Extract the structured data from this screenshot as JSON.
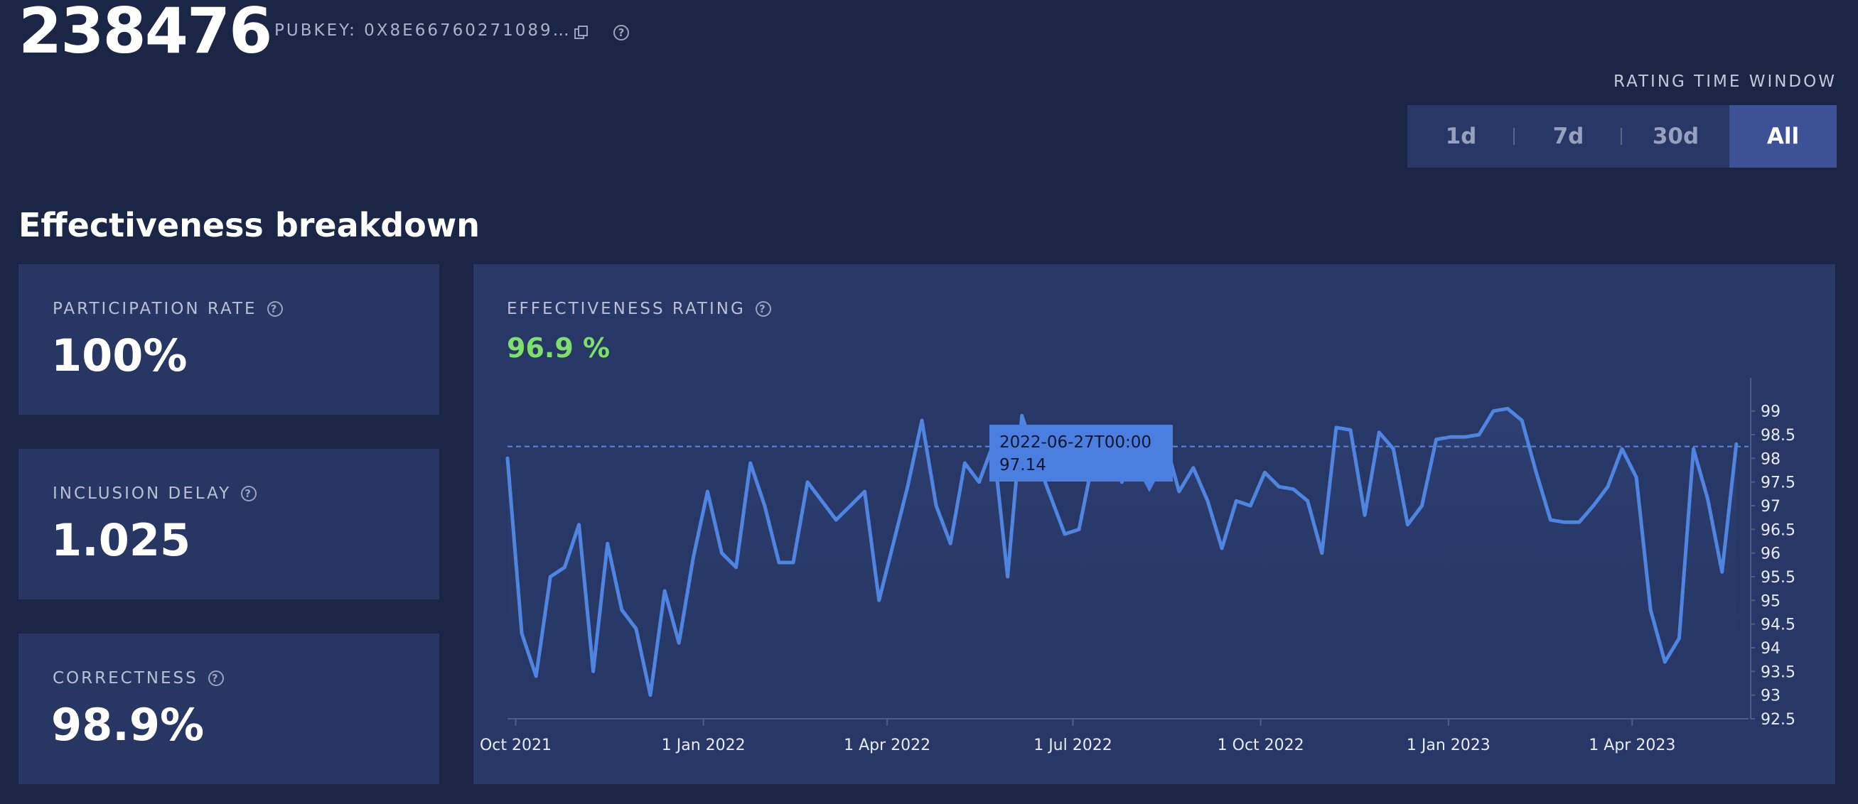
{
  "header": {
    "validator_index": "238476",
    "pubkey": "PUBKEY: 0X8E66760271089…",
    "copy_icon": "copy-icon",
    "help_icon": "help-circle-icon"
  },
  "time_window": {
    "label": "RATING TIME WINDOW",
    "options": [
      "1d",
      "7d",
      "30d",
      "All"
    ],
    "selected": "All"
  },
  "section_title": "Effectiveness breakdown",
  "metrics": [
    {
      "label": "PARTICIPATION RATE",
      "value": "100%"
    },
    {
      "label": "INCLUSION DELAY",
      "value": "1.025"
    },
    {
      "label": "CORRECTNESS",
      "value": "98.9%"
    }
  ],
  "rating": {
    "label": "EFFECTIVENESS RATING",
    "value": "96.9 %"
  },
  "colors": {
    "background": "#1b2647",
    "panel": "#283866",
    "line": "#4f85e0",
    "rating_value": "#7ee06a",
    "tooltip": "#4a7fe0"
  },
  "chart_data": {
    "type": "line",
    "title": "",
    "xlabel": "",
    "ylabel": "",
    "ylim": [
      92.5,
      99.4
    ],
    "xlim": [
      "2021-09-27",
      "2023-05-28"
    ],
    "x_ticks": [
      "Oct 2021",
      "1 Jan 2022",
      "1 Apr 2022",
      "1 Jul 2022",
      "1 Oct 2022",
      "1 Jan 2023",
      "1 Apr 2023"
    ],
    "y_ticks": [
      92.5,
      93,
      93.5,
      94,
      94.5,
      95,
      95.5,
      96,
      96.5,
      97,
      97.5,
      98,
      98.5,
      99
    ],
    "y_axis_side": "right",
    "grid": false,
    "reference_line": {
      "value": 98.25,
      "style": "dashed"
    },
    "tooltip": {
      "date": "2022-06-27T00:00",
      "value": "97.14"
    },
    "series": [
      {
        "points": [
          [
            "2021-09-27",
            98.0
          ],
          [
            "2021-10-04",
            94.3
          ],
          [
            "2021-10-11",
            93.4
          ],
          [
            "2021-10-18",
            95.5
          ],
          [
            "2021-10-25",
            95.7
          ],
          [
            "2021-11-01",
            96.6
          ],
          [
            "2021-11-08",
            93.5
          ],
          [
            "2021-11-15",
            96.2
          ],
          [
            "2021-11-22",
            94.8
          ],
          [
            "2021-11-29",
            94.4
          ],
          [
            "2021-12-06",
            93.0
          ],
          [
            "2021-12-13",
            95.2
          ],
          [
            "2021-12-20",
            94.1
          ],
          [
            "2021-12-27",
            95.9
          ],
          [
            "2022-01-03",
            97.3
          ],
          [
            "2022-01-10",
            96.0
          ],
          [
            "2022-01-17",
            95.7
          ],
          [
            "2022-01-24",
            97.9
          ],
          [
            "2022-01-31",
            97.0
          ],
          [
            "2022-02-07",
            95.8
          ],
          [
            "2022-02-14",
            95.8
          ],
          [
            "2022-02-21",
            97.5
          ],
          [
            "2022-02-28",
            97.1
          ],
          [
            "2022-03-07",
            96.7
          ],
          [
            "2022-03-14",
            97.0
          ],
          [
            "2022-03-21",
            97.3
          ],
          [
            "2022-03-28",
            95.0
          ],
          [
            "2022-04-04",
            96.2
          ],
          [
            "2022-04-11",
            97.4
          ],
          [
            "2022-04-18",
            98.8
          ],
          [
            "2022-04-25",
            97.0
          ],
          [
            "2022-05-02",
            96.2
          ],
          [
            "2022-05-09",
            97.9
          ],
          [
            "2022-05-16",
            97.5
          ],
          [
            "2022-05-23",
            98.3
          ],
          [
            "2022-05-30",
            95.5
          ],
          [
            "2022-06-06",
            98.9
          ],
          [
            "2022-06-13",
            98.0
          ],
          [
            "2022-06-20",
            97.2
          ],
          [
            "2022-06-27",
            96.4
          ],
          [
            "2022-07-04",
            96.5
          ],
          [
            "2022-07-11",
            98.0
          ],
          [
            "2022-07-18",
            98.3
          ],
          [
            "2022-07-25",
            97.5
          ],
          [
            "2022-08-01",
            98.4
          ],
          [
            "2022-08-08",
            98.6
          ],
          [
            "2022-08-15",
            98.4
          ],
          [
            "2022-08-22",
            97.3
          ],
          [
            "2022-08-29",
            97.8
          ],
          [
            "2022-09-05",
            97.1
          ],
          [
            "2022-09-12",
            96.1
          ],
          [
            "2022-09-19",
            97.1
          ],
          [
            "2022-09-26",
            97.0
          ],
          [
            "2022-10-03",
            97.7
          ],
          [
            "2022-10-10",
            97.4
          ],
          [
            "2022-10-17",
            97.35
          ],
          [
            "2022-10-24",
            97.1
          ],
          [
            "2022-10-31",
            96.0
          ],
          [
            "2022-11-07",
            98.65
          ],
          [
            "2022-11-14",
            98.6
          ],
          [
            "2022-11-21",
            96.8
          ],
          [
            "2022-11-28",
            98.55
          ],
          [
            "2022-12-05",
            98.2
          ],
          [
            "2022-12-12",
            96.6
          ],
          [
            "2022-12-19",
            97.0
          ],
          [
            "2022-12-26",
            98.4
          ],
          [
            "2023-01-02",
            98.45
          ],
          [
            "2023-01-09",
            98.45
          ],
          [
            "2023-01-16",
            98.5
          ],
          [
            "2023-01-23",
            99.0
          ],
          [
            "2023-01-30",
            99.05
          ],
          [
            "2023-02-06",
            98.8
          ],
          [
            "2023-02-13",
            97.7
          ],
          [
            "2023-02-20",
            96.7
          ],
          [
            "2023-02-27",
            96.65
          ],
          [
            "2023-03-06",
            96.65
          ],
          [
            "2023-03-13",
            97.0
          ],
          [
            "2023-03-20",
            97.4
          ],
          [
            "2023-03-27",
            98.2
          ],
          [
            "2023-04-03",
            97.6
          ],
          [
            "2023-04-10",
            94.8
          ],
          [
            "2023-04-17",
            93.7
          ],
          [
            "2023-04-24",
            94.2
          ],
          [
            "2023-05-01",
            98.2
          ],
          [
            "2023-05-08",
            97.14
          ],
          [
            "2023-05-15",
            95.6
          ],
          [
            "2023-05-22",
            98.3
          ]
        ]
      }
    ]
  }
}
